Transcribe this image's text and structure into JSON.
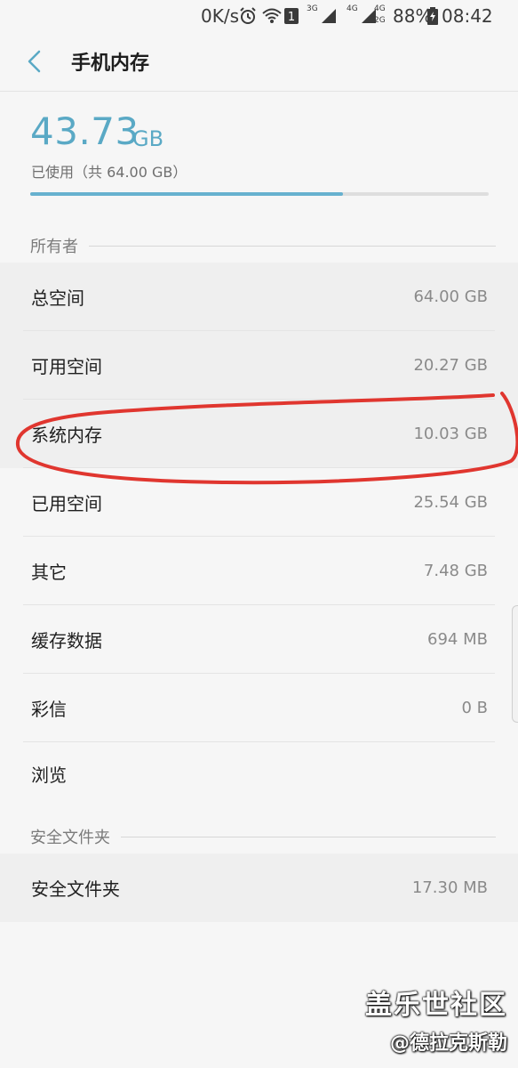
{
  "status_bar": {
    "net_speed": "0K/s",
    "notification_count": "1",
    "network_3g": "3G",
    "network_4g": "4G",
    "network_4g_2g_top": "4G",
    "network_4g_2g_bottom": "2G",
    "battery_percent": "88%",
    "time": "08:42"
  },
  "header": {
    "title": "手机内存"
  },
  "summary": {
    "used_value": "43.73",
    "used_unit": "GB",
    "used_label": "已使用（共 64.00 GB）",
    "used_fraction": 0.683
  },
  "sections": {
    "owner": {
      "title": "所有者",
      "rows": [
        {
          "label": "总空间",
          "value": "64.00 GB"
        },
        {
          "label": "可用空间",
          "value": "20.27 GB"
        },
        {
          "label": "系统内存",
          "value": "10.03 GB"
        },
        {
          "label": "已用空间",
          "value": "25.54 GB"
        },
        {
          "label": "其它",
          "value": "7.48 GB"
        },
        {
          "label": "缓存数据",
          "value": "694 MB"
        },
        {
          "label": "彩信",
          "value": "0 B"
        },
        {
          "label": "浏览",
          "value": ""
        }
      ]
    },
    "secure_folder": {
      "title": "安全文件夹",
      "rows": [
        {
          "label": "安全文件夹",
          "value": "17.30 MB"
        }
      ]
    }
  },
  "watermark": {
    "main": "盖乐世社区",
    "sub": "@德拉克斯勒"
  },
  "icons": {
    "back": "chevron-left-icon",
    "alarm": "alarm-icon",
    "wifi": "wifi-icon",
    "signal": "signal-icon",
    "battery": "battery-charging-icon"
  },
  "colors": {
    "accent": "#5aa9c5",
    "annotation": "#e0362f"
  }
}
